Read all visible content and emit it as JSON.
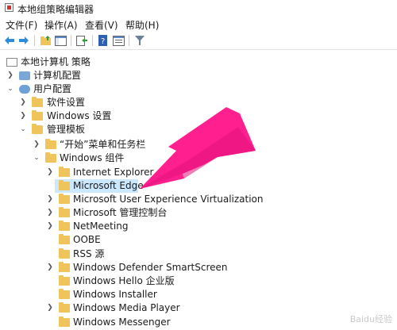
{
  "window": {
    "title": "本地组策略编辑器"
  },
  "menu": [
    "文件(F)",
    "操作(A)",
    "查看(V)",
    "帮助(H)"
  ],
  "tree": [
    {
      "label": "本地计算机 策略",
      "level": 0
    },
    {
      "label": "计算机配置",
      "level": 1,
      "expander": "collapsed"
    },
    {
      "label": "用户配置",
      "level": 1,
      "expander": "expanded"
    },
    {
      "label": "软件设置",
      "level": 2,
      "expander": "collapsed"
    },
    {
      "label": "Windows 设置",
      "level": 2,
      "expander": "collapsed"
    },
    {
      "label": "管理模板",
      "level": 2,
      "expander": "expanded"
    },
    {
      "label": "“开始”菜单和任务栏",
      "level": 3,
      "expander": "collapsed"
    },
    {
      "label": "Windows 组件",
      "level": 3,
      "expander": "expanded"
    },
    {
      "label": "Internet Explorer",
      "level": 4,
      "expander": "collapsed"
    },
    {
      "label": "Microsoft Edge",
      "level": 4,
      "selected": true
    },
    {
      "label": "Microsoft User Experience Virtualization",
      "level": 4,
      "expander": "collapsed"
    },
    {
      "label": "Microsoft 管理控制台",
      "level": 4,
      "expander": "collapsed"
    },
    {
      "label": "NetMeeting",
      "level": 4,
      "expander": "collapsed"
    },
    {
      "label": "OOBE",
      "level": 4
    },
    {
      "label": "RSS 源",
      "level": 4
    },
    {
      "label": "Windows Defender SmartScreen",
      "level": 4,
      "expander": "collapsed"
    },
    {
      "label": "Windows Hello 企业版",
      "level": 4
    },
    {
      "label": "Windows Installer",
      "level": 4
    },
    {
      "label": "Windows Media Player",
      "level": 4,
      "expander": "collapsed"
    },
    {
      "label": "Windows Messenger",
      "level": 4
    }
  ],
  "watermark": "Baidu经验",
  "colors": {
    "selection": "#cce8ff",
    "folder": "#efc55b",
    "arrow": "#ff1f8e"
  }
}
